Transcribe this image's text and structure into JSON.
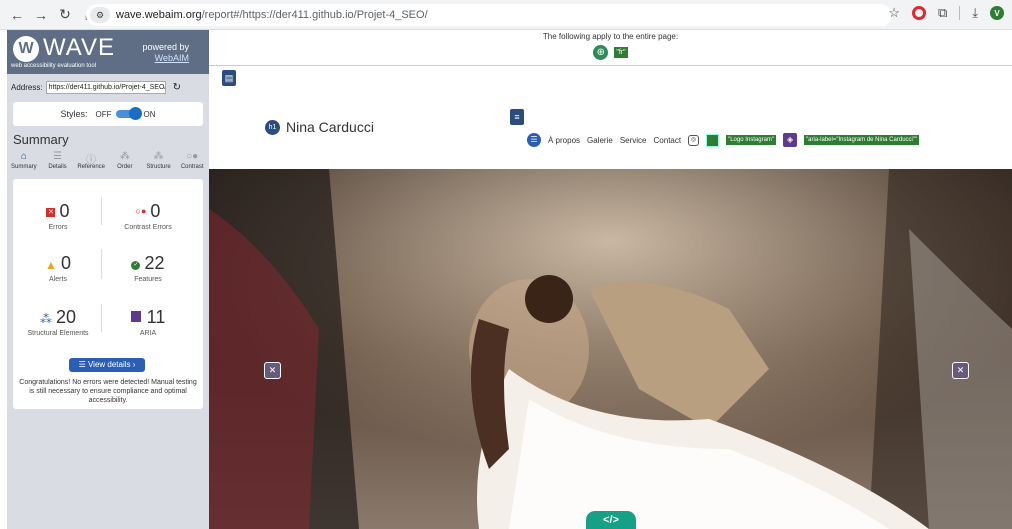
{
  "browser": {
    "url_host": "wave.webaim.org",
    "url_path": "/report#/https://der411.github.io/Projet-4_SEO/"
  },
  "wave": {
    "logo": "WAVE",
    "tagline": "web accessibility evaluation tool",
    "powered_by": "powered by",
    "webaim_link": "WebAIM",
    "address_label": "Address:",
    "address_value": "https://der411.github.io/Projet-4_SEO/",
    "styles_label": "Styles:",
    "styles_off": "OFF",
    "styles_on": "ON",
    "summary_heading": "Summary",
    "tabs": [
      {
        "label": "Summary",
        "icon": "home-icon"
      },
      {
        "label": "Details",
        "icon": "list-icon"
      },
      {
        "label": "Reference",
        "icon": "info-icon"
      },
      {
        "label": "Order",
        "icon": "order-icon"
      },
      {
        "label": "Structure",
        "icon": "structure-icon"
      },
      {
        "label": "Contrast",
        "icon": "contrast-icon"
      }
    ],
    "stats": {
      "errors": {
        "count": "0",
        "label": "Errors"
      },
      "contrast": {
        "count": "0",
        "label": "Contrast Errors"
      },
      "alerts": {
        "count": "0",
        "label": "Alerts"
      },
      "features": {
        "count": "22",
        "label": "Features"
      },
      "structural": {
        "count": "20",
        "label": "Structural Elements"
      },
      "aria": {
        "count": "11",
        "label": "ARIA"
      }
    },
    "view_details": "View details ›",
    "congrats": "Congratulations! No errors were detected! Manual testing is still necessary to ensure compliance and optimal accessibility."
  },
  "page": {
    "notice": "The following apply to the entire page:",
    "lang_tag": "\"fr\"",
    "site_name": "Nina Carducci",
    "h1_badge": "h1",
    "nav": [
      "À propos",
      "Galerie",
      "Service",
      "Contact"
    ],
    "alt_tag": "\"Logo Instagram\"",
    "aria_tag": "\"aria-label=\"Instagram de Nina Carducci\"\""
  },
  "colors": {
    "wave_header": "#5f6e85",
    "wave_sidebar": "#d9dde3",
    "primary_blue": "#2b5fb5",
    "feature_green": "#2e7d32",
    "aria_purple": "#5c3b8f",
    "error_red": "#d32f2f",
    "alert_orange": "#f4a11b"
  }
}
